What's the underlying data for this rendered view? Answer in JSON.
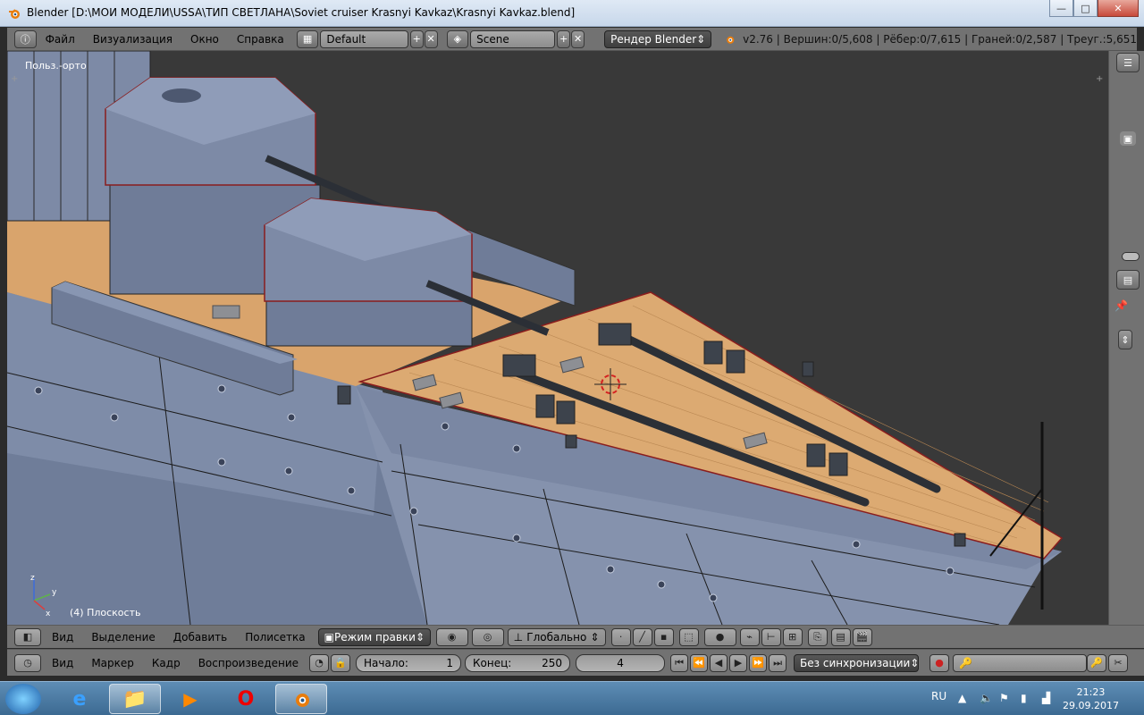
{
  "window": {
    "title": "Blender [D:\\МОИ МОДЕЛИ\\USSA\\ТИП СВЕТЛАНА\\Soviet cruiser Krasnyi Kavkaz\\Krasnyi Kavkaz.blend]",
    "minimize": "—",
    "maximize": "□",
    "close": "✕"
  },
  "info_header": {
    "menu": [
      "Файл",
      "Визуализация",
      "Окно",
      "Справка"
    ],
    "layout": "Default",
    "scene": "Scene",
    "renderer": "Рендер Blender",
    "stats": "v2.76 | Вершин:0/5,608 | Рёбер:0/7,615 | Граней:0/2,587 | Треуг.:5,651"
  },
  "viewport": {
    "view_label": "Польз.-орто",
    "object_label": "(4) Плоскость"
  },
  "view3d_header": {
    "menu": [
      "Вид",
      "Выделение",
      "Добавить",
      "Полисетка"
    ],
    "mode": "Режим правки",
    "orientation": "Глобально"
  },
  "timeline_header": {
    "menu": [
      "Вид",
      "Маркер",
      "Кадр",
      "Воспроизведение"
    ],
    "start_label": "Начало:",
    "start_value": "1",
    "end_label": "Конец:",
    "end_value": "250",
    "current_frame": "4",
    "sync": "Без синхронизации"
  },
  "taskbar": {
    "lang": "RU",
    "time": "21:23",
    "date": "29.09.2017"
  },
  "colors": {
    "accent": "#e87d0d",
    "bg_header": "#727272",
    "viewport_bg": "#393939"
  }
}
